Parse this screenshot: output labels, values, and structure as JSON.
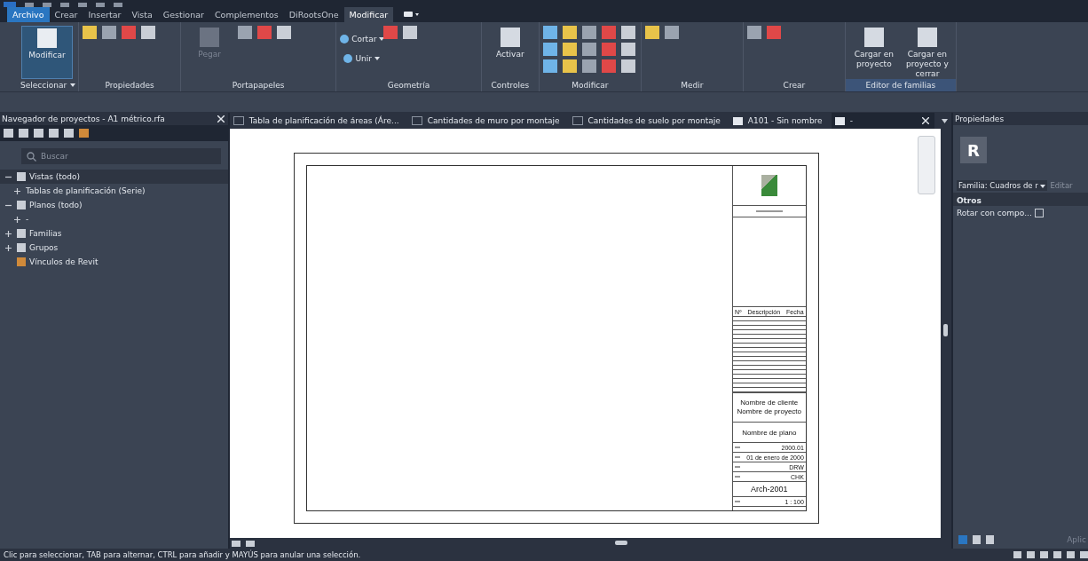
{
  "menu_tabs": [
    {
      "label": "Archivo",
      "kind": "file",
      "selected": false
    },
    {
      "label": "Crear",
      "kind": "tab",
      "selected": false
    },
    {
      "label": "Insertar",
      "kind": "tab",
      "selected": false
    },
    {
      "label": "Vista",
      "kind": "tab",
      "selected": false
    },
    {
      "label": "Gestionar",
      "kind": "tab",
      "selected": false
    },
    {
      "label": "Complementos",
      "kind": "tab",
      "selected": false
    },
    {
      "label": "DiRootsOne",
      "kind": "tab",
      "selected": false
    },
    {
      "label": "Modificar",
      "kind": "tab",
      "selected": true
    }
  ],
  "ribbon": [
    {
      "label": "Seleccionar",
      "dropdown": true,
      "highlighted": false,
      "tools": [
        {
          "label": "Modificar",
          "kind": "large",
          "selected": true
        }
      ]
    },
    {
      "label": "Propiedades",
      "dropdown": false,
      "highlighted": false,
      "tools": [
        {
          "kind": "icons"
        }
      ]
    },
    {
      "label": "Portapapeles",
      "dropdown": false,
      "highlighted": false,
      "tools": [
        {
          "label": "Pegar",
          "kind": "large",
          "selected": false,
          "disabled": true
        },
        {
          "kind": "icons"
        }
      ]
    },
    {
      "label": "Geometría",
      "dropdown": false,
      "highlighted": false,
      "tools": [
        {
          "label": "Cortar",
          "kind": "small"
        },
        {
          "label": "Unir",
          "kind": "small"
        },
        {
          "kind": "icons"
        }
      ]
    },
    {
      "label": "Controles",
      "dropdown": false,
      "highlighted": false,
      "tools": [
        {
          "label": "Activar",
          "kind": "large",
          "selected": false
        }
      ]
    },
    {
      "label": "Modificar",
      "dropdown": false,
      "highlighted": false,
      "tools": [
        {
          "kind": "icons"
        }
      ]
    },
    {
      "label": "Medir",
      "dropdown": false,
      "highlighted": false,
      "tools": [
        {
          "kind": "icons"
        }
      ]
    },
    {
      "label": "Crear",
      "dropdown": false,
      "highlighted": false,
      "tools": [
        {
          "kind": "icons"
        }
      ]
    },
    {
      "label": "Editor de familias",
      "dropdown": false,
      "highlighted": true,
      "tools": [
        {
          "label": "Cargar en proyecto",
          "kind": "large",
          "selected": false
        },
        {
          "label": "Cargar en proyecto y cerrar",
          "kind": "large",
          "selected": false
        }
      ]
    }
  ],
  "browser": {
    "title": "Navegador de proyectos - A1 métrico.rfa",
    "search": {
      "placeholder": "Buscar"
    },
    "tree": [
      {
        "label": "Vistas (todo)",
        "selected": true,
        "expanded": true,
        "children": [
          {
            "label": "Tablas de planificación (Serie)",
            "selected": false,
            "expanded": false
          }
        ]
      },
      {
        "label": "Planos (todo)",
        "selected": false,
        "expanded": true,
        "children": [
          {
            "label": "-",
            "selected": false,
            "expanded": false
          }
        ]
      },
      {
        "label": "Familias",
        "selected": false,
        "expanded": false
      },
      {
        "label": "Grupos",
        "selected": false,
        "expanded": false
      },
      {
        "label": "Vínculos de Revit",
        "selected": false
      }
    ]
  },
  "view_tabs": [
    {
      "label": "Tabla de planificación de áreas (Áre...",
      "kind": "schedule",
      "selected": false
    },
    {
      "label": "Cantidades de muro por montaje",
      "kind": "schedule",
      "selected": false
    },
    {
      "label": "Cantidades de suelo por montaje",
      "kind": "schedule",
      "selected": false
    },
    {
      "label": "A101 - Sin nombre",
      "kind": "sheet",
      "selected": false
    },
    {
      "label": "-",
      "kind": "sheet",
      "selected": true
    }
  ],
  "title_block": {
    "revision_columns": [
      "Nº",
      "Descripción",
      "Fecha"
    ],
    "client": "Nombre de cliente",
    "project": "Nombre de proyecto",
    "sheet_name": "Nombre de plano",
    "info_values": [
      "2000.01",
      "01 de enero de 2000",
      "DRW",
      "CHK"
    ],
    "sheet_number": "Arch-2001",
    "scale": "1 : 100"
  },
  "properties": {
    "title": "Propiedades",
    "type_icon": "R",
    "type_selector": "Familia: Cuadros de r",
    "edit_button": "Editar",
    "group": "Otros",
    "rows": [
      {
        "label": "Rotar con compo...",
        "checked": false
      }
    ],
    "apply_button": "Aplic"
  },
  "status_bar": {
    "message": "Clic para seleccionar, TAB para alternar, CTRL para añadir y MAYÚS para anular una selección."
  }
}
